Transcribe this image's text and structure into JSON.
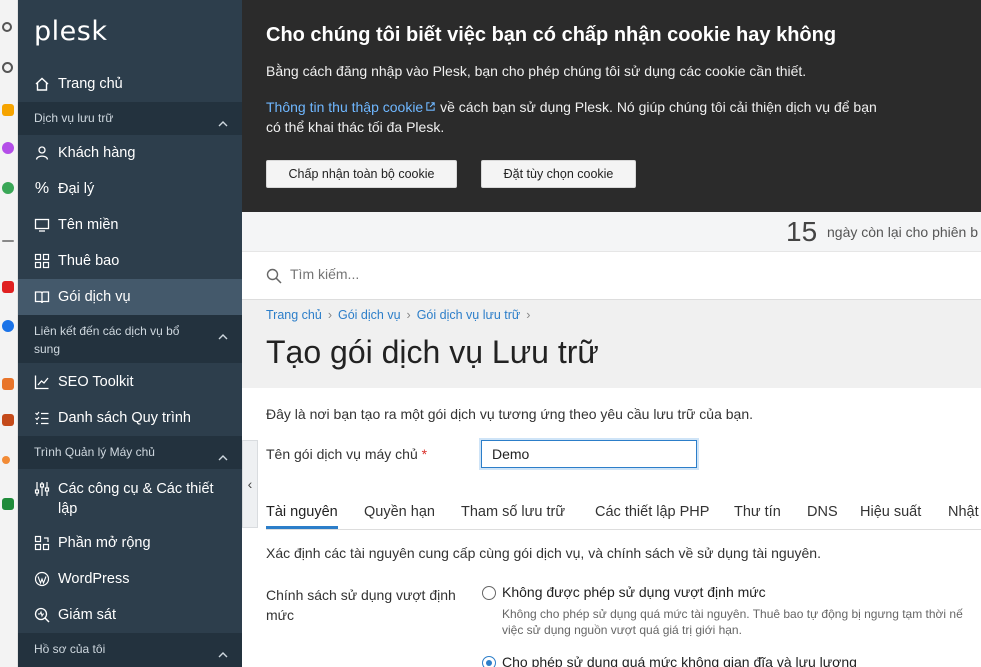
{
  "sidebar": {
    "logo": "plesk",
    "home": "Trang chủ",
    "group_hosting": "Dịch vụ lưu trữ",
    "items_hosting": [
      "Khách hàng",
      "Đại lý",
      "Tên miền",
      "Thuê bao",
      "Gói dịch vụ"
    ],
    "group_links": "Liên kết đến các dịch vụ bổ sung",
    "items_links": [
      "SEO Toolkit",
      "Danh sách Quy trình"
    ],
    "group_server": "Trình Quản lý Máy chủ",
    "items_server": [
      "Các công cụ & Các thiết lập",
      "Phần mở rộng",
      "WordPress",
      "Giám sát"
    ],
    "group_profile": "Hồ sơ của tôi"
  },
  "cookie": {
    "title": "Cho chúng tôi biết việc bạn có chấp nhận cookie hay không",
    "line1": "Bằng cách đăng nhập vào Plesk, bạn cho phép chúng tôi sử dụng các cookie cần thiết.",
    "link": "Thông tin thu thập cookie",
    "line2_rest": " về cách bạn sử dụng Plesk. Nó giúp chúng tôi cải thiện dịch vụ để bạn",
    "line3": "có thể khai thác tối đa Plesk.",
    "accept_all": "Chấp nhận toàn bộ cookie",
    "settings": "Đặt tùy chọn cookie"
  },
  "trial": {
    "days": "15",
    "text": "ngày còn lại cho phiên b"
  },
  "search": {
    "placeholder": "Tìm kiếm..."
  },
  "breadcrumb": [
    "Trang chủ",
    "Gói dịch vụ",
    "Gói dịch vụ lưu trữ"
  ],
  "page_title": "Tạo gói dịch vụ Lưu trữ",
  "form": {
    "intro": "Đây là nơi bạn tạo ra một gói dịch vụ tương ứng theo yêu cầu lưu trữ của bạn.",
    "name_label": "Tên gói dịch vụ máy chủ",
    "name_required": "*",
    "name_value": "Demo"
  },
  "tabs": [
    "Tài nguyên",
    "Quyền hạn",
    "Tham số lưu trữ",
    "Các thiết lập PHP",
    "Thư tín",
    "DNS",
    "Hiệu suất",
    "Nhật"
  ],
  "resources": {
    "desc": "Xác định các tài nguyên cung cấp cùng gói dịch vụ, và chính sách về sử dụng tài nguyên.",
    "policy_label": "Chính sách sử dụng vượt định mức",
    "opt1": "Không được phép sử dụng vượt định mức",
    "opt1_hint_1": "Không cho phép sử dụng quá mức tài nguyên. Thuê bao tự động bị ngưng tạm thời nế",
    "opt1_hint_2": "việc sử dụng nguồn vượt quá giá trị giới hạn.",
    "opt2": "Cho phép sử dụng quá mức không gian đĩa và lưu lượng"
  },
  "colors": {
    "sidebar": "#2d3e4c",
    "accent": "#2c7ec9",
    "cookie_bg": "#2b2b2b"
  }
}
